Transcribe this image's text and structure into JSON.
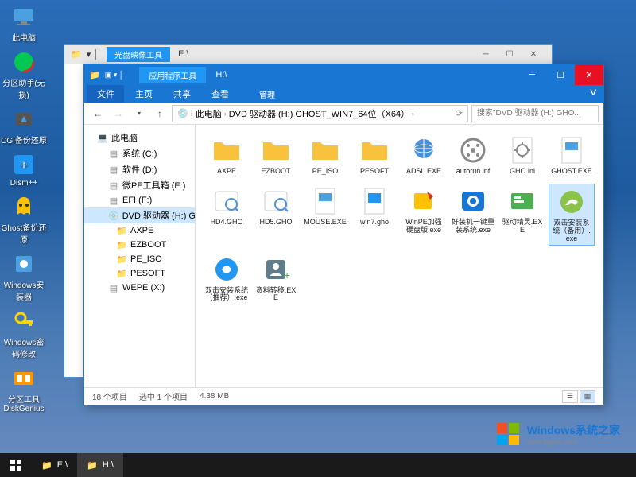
{
  "desktop_icons": [
    {
      "name": "pc",
      "label": "此电脑",
      "color": "#4aa0e0"
    },
    {
      "name": "partition",
      "label": "分区助手(无损)",
      "color": "#00c853"
    },
    {
      "name": "cgi",
      "label": "CGI备份还原",
      "color": "#666"
    },
    {
      "name": "dism",
      "label": "Dism++",
      "color": "#2196f3"
    },
    {
      "name": "ghost",
      "label": "Ghost备份还原",
      "color": "#ffc107"
    },
    {
      "name": "wininst",
      "label": "Windows安装器",
      "color": "#4aa0e0"
    },
    {
      "name": "winpwd",
      "label": "Windows密码修改",
      "color": "#ffd700"
    },
    {
      "name": "diskgenius",
      "label": "分区工具DiskGenius",
      "color": "#ff9800"
    }
  ],
  "back_window": {
    "context": "光盘映像工具",
    "title": "E:\\"
  },
  "front_window": {
    "context": "应用程序工具",
    "title": "H:\\",
    "menus": {
      "file": "文件",
      "home": "主页",
      "share": "共享",
      "view": "查看",
      "manage": "管理"
    },
    "breadcrumb": [
      "此电脑",
      "DVD 驱动器 (H:) GHOST_WIN7_64位（X64）"
    ],
    "search_placeholder": "搜索\"DVD 驱动器 (H:) GHO...",
    "tree": [
      {
        "label": "此电脑",
        "level": 0,
        "icon": "pc"
      },
      {
        "label": "系统 (C:)",
        "level": 1,
        "icon": "drive"
      },
      {
        "label": "软件 (D:)",
        "level": 1,
        "icon": "drive"
      },
      {
        "label": "微PE工具箱 (E:)",
        "level": 1,
        "icon": "drive"
      },
      {
        "label": "EFI (F:)",
        "level": 1,
        "icon": "drive"
      },
      {
        "label": "DVD 驱动器 (H:) G...",
        "level": 1,
        "icon": "dvd",
        "selected": true
      },
      {
        "label": "AXPE",
        "level": 2,
        "icon": "folder"
      },
      {
        "label": "EZBOOT",
        "level": 2,
        "icon": "folder"
      },
      {
        "label": "PE_ISO",
        "level": 2,
        "icon": "folder"
      },
      {
        "label": "PESOFT",
        "level": 2,
        "icon": "folder"
      },
      {
        "label": "WEPE (X:)",
        "level": 1,
        "icon": "drive"
      }
    ],
    "files": [
      {
        "name": "AXPE",
        "type": "folder"
      },
      {
        "name": "EZBOOT",
        "type": "folder"
      },
      {
        "name": "PE_ISO",
        "type": "folder"
      },
      {
        "name": "PESOFT",
        "type": "folder"
      },
      {
        "name": "ADSL.EXE",
        "type": "exe-net"
      },
      {
        "name": "autorun.inf",
        "type": "inf"
      },
      {
        "name": "GHO.ini",
        "type": "ini"
      },
      {
        "name": "GHOST.EXE",
        "type": "exe-ghost"
      },
      {
        "name": "HD4.GHO",
        "type": "gho"
      },
      {
        "name": "HD5.GHO",
        "type": "gho"
      },
      {
        "name": "MOUSE.EXE",
        "type": "exe-generic"
      },
      {
        "name": "win7.gho",
        "type": "gho2"
      },
      {
        "name": "WinPE加强硬盘版.exe",
        "type": "exe-pe"
      },
      {
        "name": "好装机一键重装系统.exe",
        "type": "exe-eye"
      },
      {
        "name": "驱动精灵.EXE",
        "type": "exe-driver"
      },
      {
        "name": "双击安装系统（备用）.exe",
        "type": "exe-install2",
        "selected": true
      },
      {
        "name": "双击安装系统（推荐）.exe",
        "type": "exe-install"
      },
      {
        "name": "资料转移.EXE",
        "type": "exe-transfer"
      }
    ],
    "status": {
      "count": "18 个项目",
      "selection": "选中 1 个项目",
      "size": "4.38 MB"
    }
  },
  "taskbar": [
    {
      "label": "E:\\",
      "active": false
    },
    {
      "label": "H:\\",
      "active": true
    }
  ],
  "watermark": {
    "text": "Windows系统之家",
    "url": "www.bjjmlv.com"
  }
}
